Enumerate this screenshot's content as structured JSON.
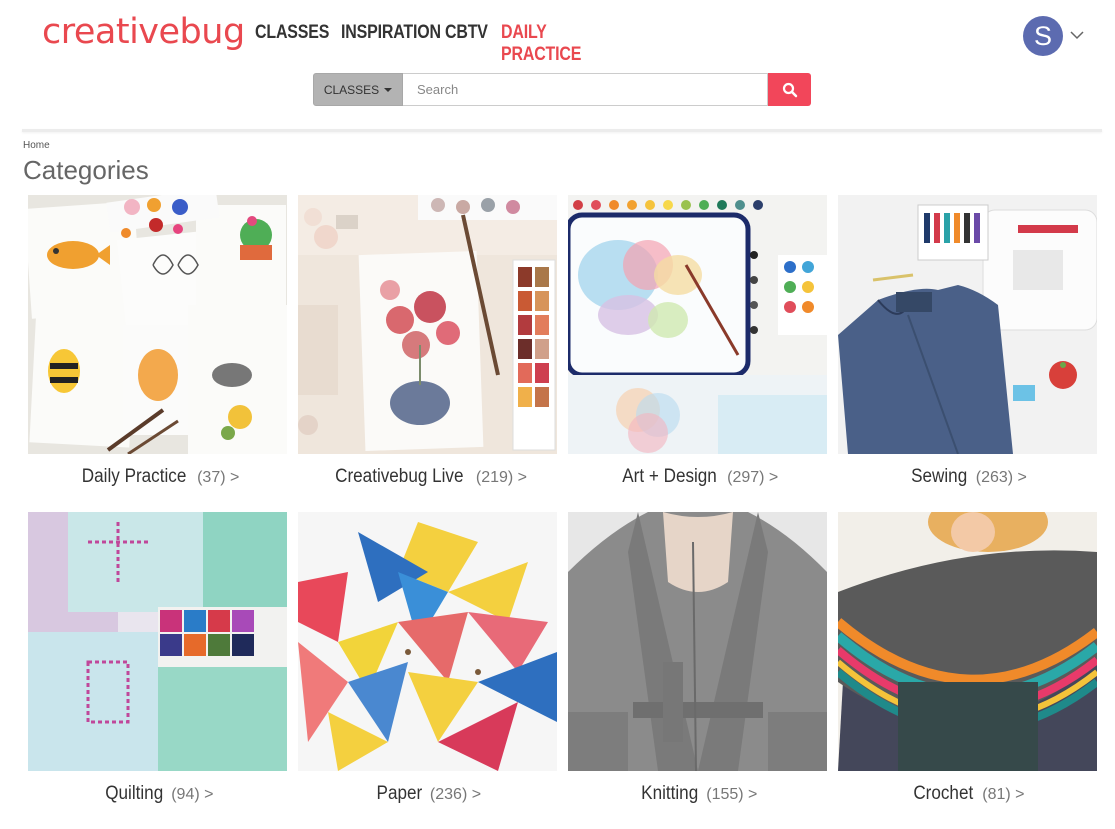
{
  "header": {
    "logo": "creativebug",
    "nav": [
      "CLASSES",
      "INSPIRATION",
      "CBTV",
      "DAILY PRACTICE"
    ],
    "active_nav": "DAILY PRACTICE",
    "avatar_initial": "S"
  },
  "search": {
    "category_label": "CLASSES",
    "placeholder": "Search",
    "value": ""
  },
  "breadcrumb": "Home",
  "page_title": "Categories",
  "categories": [
    {
      "name": "Daily Practice",
      "count": "(37) >"
    },
    {
      "name": "Creativebug Live",
      "count": "(219) >"
    },
    {
      "name": "Art + Design",
      "count": "(297) >"
    },
    {
      "name": "Sewing",
      "count": "(263) >"
    },
    {
      "name": "Quilting",
      "count": "(94) >"
    },
    {
      "name": "Paper",
      "count": "(236) >"
    },
    {
      "name": "Knitting",
      "count": "(155) >"
    },
    {
      "name": "Crochet",
      "count": "(81) >"
    }
  ],
  "colors": {
    "brand": "#e9484f",
    "avatar": "#5c6bb0",
    "search_button": "#f2465a"
  }
}
